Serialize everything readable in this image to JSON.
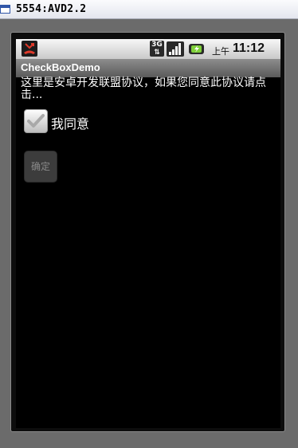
{
  "window": {
    "title": "5554:AVD2.2"
  },
  "statusbar": {
    "network": "3G",
    "ampm": "上午",
    "time": "11:12"
  },
  "app": {
    "title": "CheckBoxDemo"
  },
  "content": {
    "agreement_text": "这里是安卓开发联盟协议，如果您同意此协议请点击...",
    "checkbox_label": "我同意",
    "checkbox_checked": true,
    "confirm_label": "确定",
    "confirm_enabled": false
  }
}
